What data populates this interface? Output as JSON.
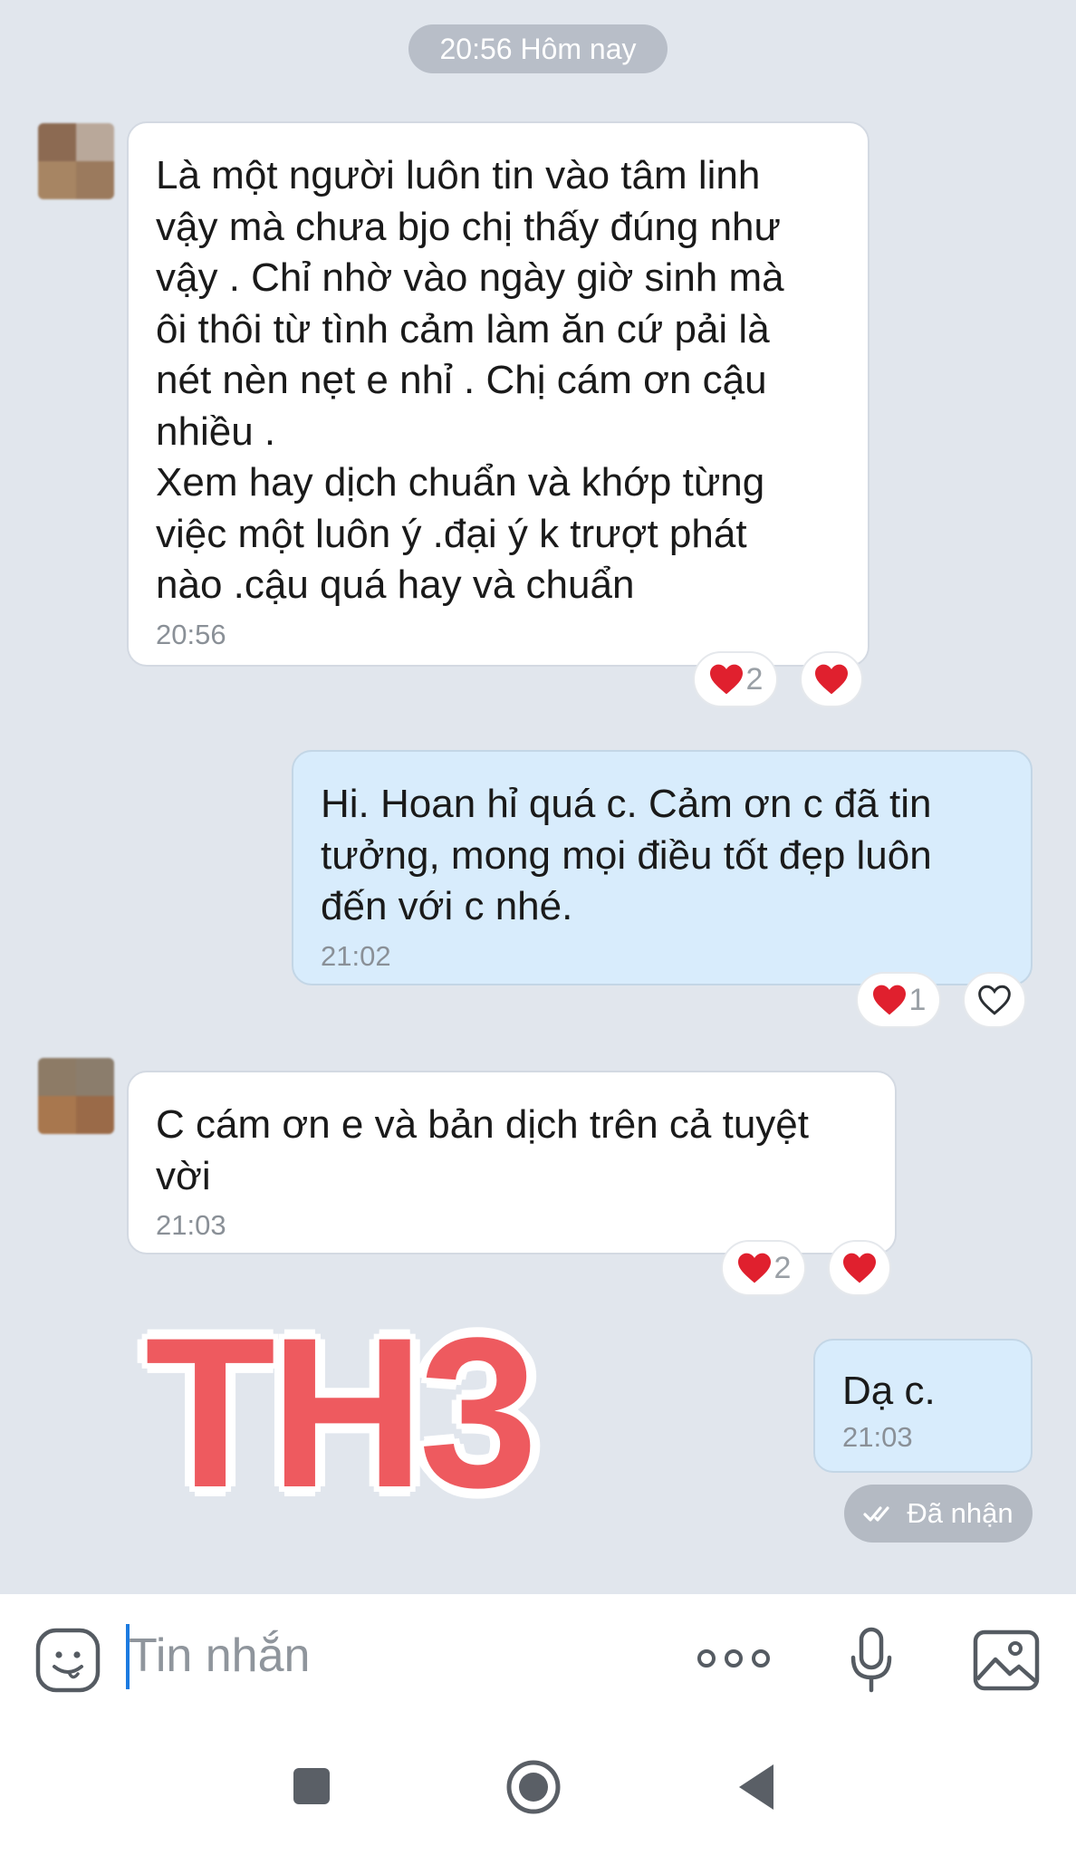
{
  "date_separator": "20:56 Hôm nay",
  "messages": [
    {
      "side": "in",
      "text": "Là một người luôn tin vào tâm linh\nvậy mà chưa bjo chị thấy đúng như\nvậy . Chỉ nhờ vào ngày giờ sinh mà\nôi thôi từ tình cảm làm ăn cứ pải là\nnét nèn nẹt e nhỉ . Chị cám ơn cậu\nnhiều .\nXem hay dịch chuẩn và khớp từng\nviệc một luôn ý .đại ý k trượt phát\nnào .cậu quá hay và chuẩn",
      "time": "20:56",
      "reaction_count": "2"
    },
    {
      "side": "out",
      "text": "Hi. Hoan hỉ quá c. Cảm ơn c đã tin\ntưởng, mong mọi điều tốt đẹp luôn\nđến với c nhé.",
      "time": "21:02",
      "reaction_count": "1"
    },
    {
      "side": "in",
      "text": "C cám ơn e và bản dịch trên cả tuyệt\nvời",
      "time": "21:03",
      "reaction_count": "2"
    },
    {
      "side": "out",
      "text": "Dạ c.",
      "time": "21:03"
    }
  ],
  "watermark": "TH3",
  "status": "Đã nhận",
  "composer": {
    "placeholder": "Tin nhắn"
  },
  "colors": {
    "background": "#e1e6ed",
    "incoming_bubble": "#ffffff",
    "outgoing_bubble": "#d8ecfc",
    "heart": "#e0202e",
    "watermark": "#ee5a5f"
  }
}
